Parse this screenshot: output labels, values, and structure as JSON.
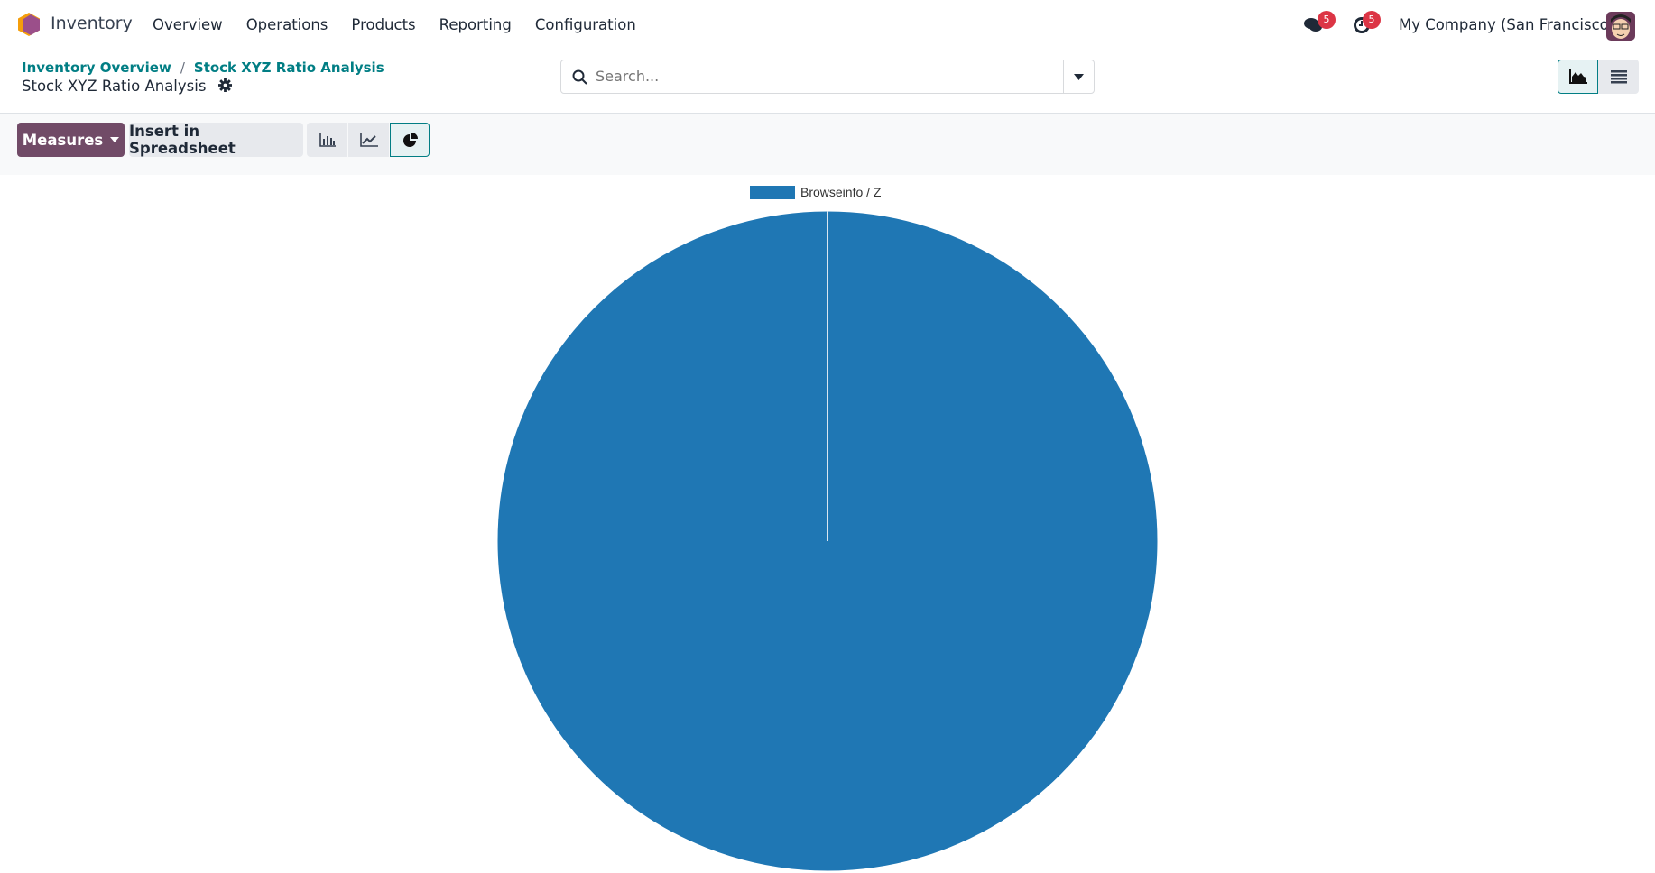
{
  "nav": {
    "app_name": "Inventory",
    "menu": [
      "Overview",
      "Operations",
      "Products",
      "Reporting",
      "Configuration"
    ],
    "messages_count": "5",
    "activities_count": "5",
    "company": "My Company (San Francisco)"
  },
  "breadcrumb": {
    "items": [
      "Inventory Overview",
      "Stock XYZ Ratio Analysis"
    ],
    "separator": "/"
  },
  "page_title": "Stock XYZ Ratio Analysis",
  "search": {
    "placeholder": "Search..."
  },
  "toolbar": {
    "measures_label": "Measures",
    "insert_label": "Insert in Spreadsheet",
    "active_chart": "pie"
  },
  "colors": {
    "accent": "#017e84",
    "primary": "#714b67",
    "slice": "#1f77b4"
  },
  "chart_data": {
    "type": "pie",
    "labels": [
      "Browseinfo / Z"
    ],
    "values": [
      100
    ],
    "legend": "top",
    "colors": [
      "#1f77b4"
    ]
  }
}
